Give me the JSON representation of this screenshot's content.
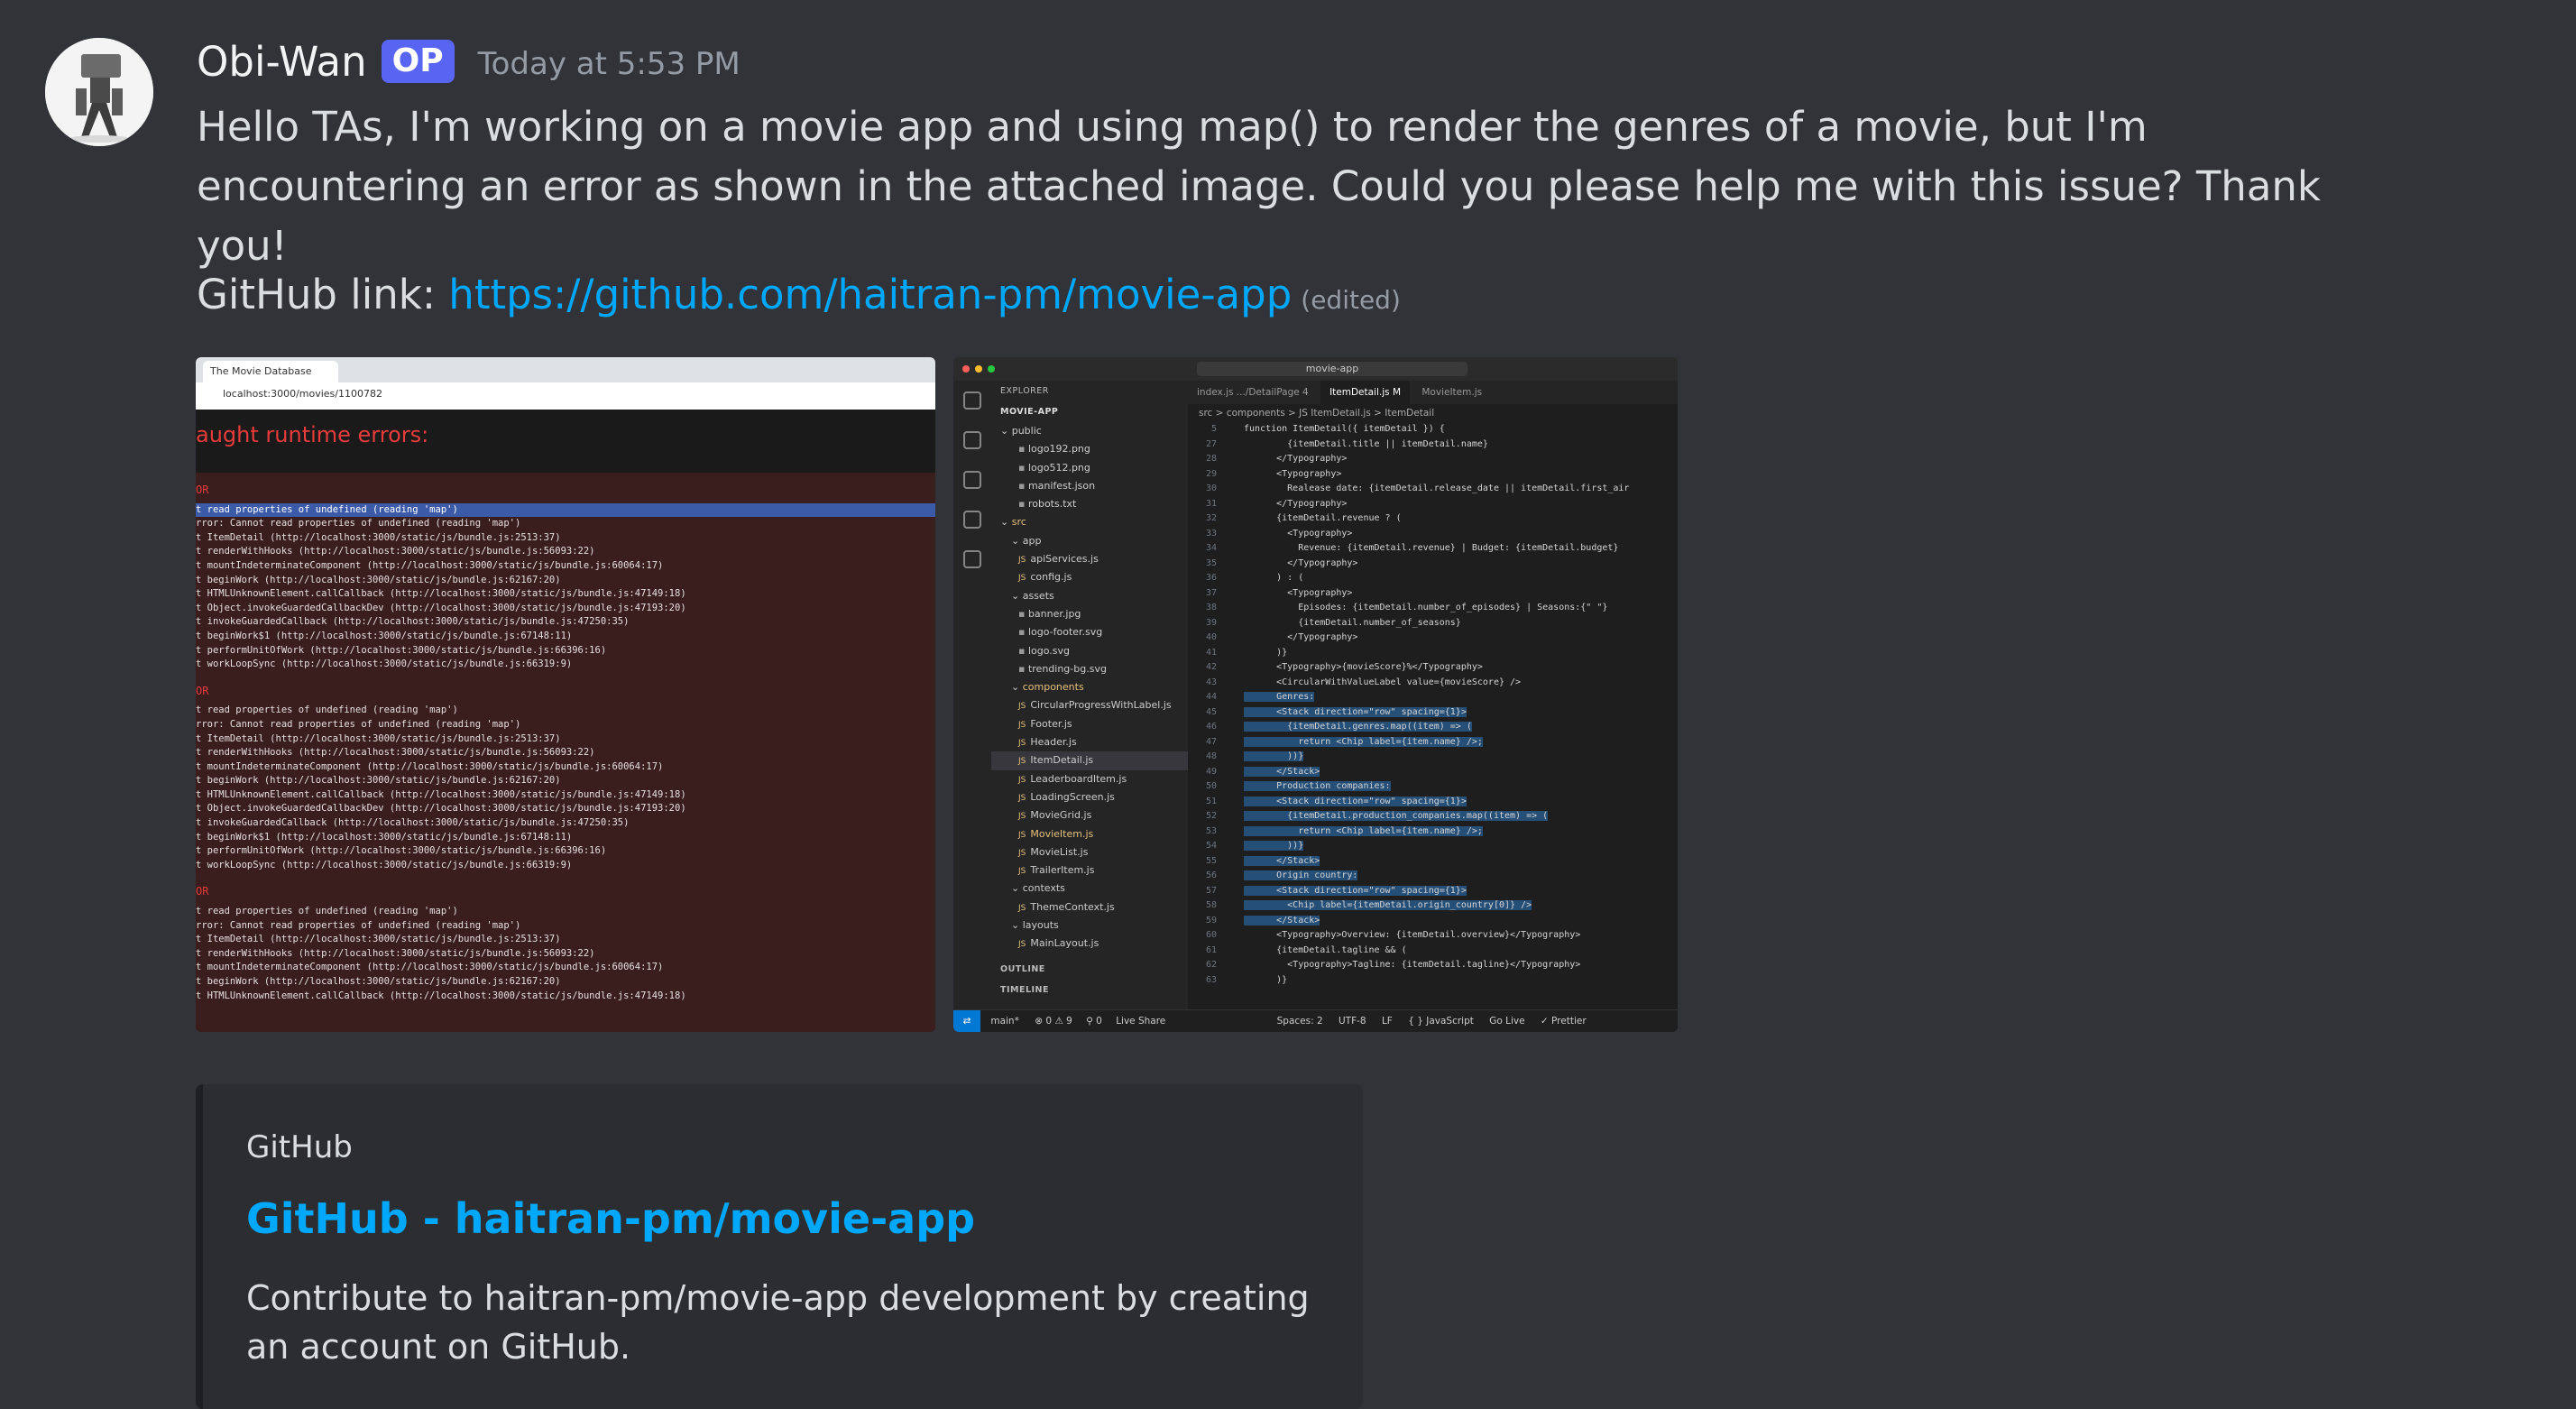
{
  "message": {
    "author": "Obi-Wan",
    "badge": "OP",
    "timestamp": "Today at 5:53 PM",
    "text": "Hello TAs, I'm working on a movie app and using map() to render the genres of a movie, but I'm encountering an error as shown in the attached image. Could you please help me with this issue? Thank you!",
    "github_prefix": "GitHub link: ",
    "github_url": "https://github.com/haitran-pm/movie-app",
    "edited": "(edited)"
  },
  "attachment_browser": {
    "tab_title": "The Movie Database",
    "url": "localhost:3000/movies/1100782",
    "heading": "aught runtime errors:",
    "error_header": "OR",
    "lines": [
      "t read properties of undefined (reading 'map')",
      "rror: Cannot read properties of undefined (reading 'map')",
      "t ItemDetail (http://localhost:3000/static/js/bundle.js:2513:37)",
      "t renderWithHooks (http://localhost:3000/static/js/bundle.js:56093:22)",
      "t mountIndeterminateComponent (http://localhost:3000/static/js/bundle.js:60064:17)",
      "t beginWork (http://localhost:3000/static/js/bundle.js:62167:20)",
      "t HTMLUnknownElement.callCallback (http://localhost:3000/static/js/bundle.js:47149:18)",
      "t Object.invokeGuardedCallbackDev (http://localhost:3000/static/js/bundle.js:47193:20)",
      "t invokeGuardedCallback (http://localhost:3000/static/js/bundle.js:47250:35)",
      "t beginWork$1 (http://localhost:3000/static/js/bundle.js:67148:11)",
      "t performUnitOfWork (http://localhost:3000/static/js/bundle.js:66396:16)",
      "t workLoopSync (http://localhost:3000/static/js/bundle.js:66319:9)"
    ]
  },
  "attachment_vscode": {
    "search": "movie-app",
    "explorer_title": "EXPLORER",
    "project": "MOVIE-APP",
    "files": [
      {
        "name": "public",
        "kind": "folder"
      },
      {
        "name": "logo192.png",
        "kind": "file"
      },
      {
        "name": "logo512.png",
        "kind": "file"
      },
      {
        "name": "manifest.json",
        "kind": "file"
      },
      {
        "name": "robots.txt",
        "kind": "file"
      },
      {
        "name": "src",
        "kind": "folder"
      },
      {
        "name": "app",
        "kind": "folder"
      },
      {
        "name": "apiServices.js",
        "kind": "js"
      },
      {
        "name": "config.js",
        "kind": "js"
      },
      {
        "name": "assets",
        "kind": "folder"
      },
      {
        "name": "banner.jpg",
        "kind": "file"
      },
      {
        "name": "logo-footer.svg",
        "kind": "file"
      },
      {
        "name": "logo.svg",
        "kind": "file"
      },
      {
        "name": "trending-bg.svg",
        "kind": "file"
      },
      {
        "name": "components",
        "kind": "folder"
      },
      {
        "name": "CircularProgressWithLabel.js",
        "kind": "js"
      },
      {
        "name": "Footer.js",
        "kind": "js"
      },
      {
        "name": "Header.js",
        "kind": "js"
      },
      {
        "name": "ItemDetail.js",
        "kind": "js"
      },
      {
        "name": "LeaderboardItem.js",
        "kind": "js"
      },
      {
        "name": "LoadingScreen.js",
        "kind": "js"
      },
      {
        "name": "MovieGrid.js",
        "kind": "js"
      },
      {
        "name": "MovieItem.js",
        "kind": "js"
      },
      {
        "name": "MovieList.js",
        "kind": "js"
      },
      {
        "name": "TrailerItem.js",
        "kind": "js"
      },
      {
        "name": "contexts",
        "kind": "folder"
      },
      {
        "name": "ThemeContext.js",
        "kind": "js"
      },
      {
        "name": "layouts",
        "kind": "folder"
      },
      {
        "name": "MainLayout.js",
        "kind": "js"
      }
    ],
    "outline": "OUTLINE",
    "timeline": "TIMELINE",
    "tabs": [
      "index.js .../DetailPage 4",
      "ItemDetail.js M",
      "MovieItem.js"
    ],
    "breadcrumb": "src > components > JS ItemDetail.js > ItemDetail",
    "code": [
      {
        "n": "5",
        "t": "function ItemDetail({ itemDetail }) {",
        "sel": false
      },
      {
        "n": "27",
        "t": "        {itemDetail.title || itemDetail.name}",
        "sel": false
      },
      {
        "n": "28",
        "t": "      </Typography>",
        "sel": false
      },
      {
        "n": "29",
        "t": "      <Typography>",
        "sel": false
      },
      {
        "n": "30",
        "t": "        Realease date: {itemDetail.release_date || itemDetail.first_air",
        "sel": false
      },
      {
        "n": "31",
        "t": "      </Typography>",
        "sel": false
      },
      {
        "n": "32",
        "t": "      {itemDetail.revenue ? (",
        "sel": false
      },
      {
        "n": "33",
        "t": "        <Typography>",
        "sel": false
      },
      {
        "n": "34",
        "t": "          Revenue: {itemDetail.revenue} | Budget: {itemDetail.budget}",
        "sel": false
      },
      {
        "n": "35",
        "t": "        </Typography>",
        "sel": false
      },
      {
        "n": "36",
        "t": "      ) : (",
        "sel": false
      },
      {
        "n": "37",
        "t": "        <Typography>",
        "sel": false
      },
      {
        "n": "38",
        "t": "          Episodes: {itemDetail.number_of_episodes} | Seasons:{\" \"}",
        "sel": false
      },
      {
        "n": "39",
        "t": "          {itemDetail.number_of_seasons}",
        "sel": false
      },
      {
        "n": "40",
        "t": "        </Typography>",
        "sel": false
      },
      {
        "n": "41",
        "t": "      )}",
        "sel": false
      },
      {
        "n": "42",
        "t": "      <Typography>{movieScore}%</Typography>",
        "sel": false
      },
      {
        "n": "43",
        "t": "      <CircularWithValueLabel value={movieScore} />",
        "sel": false
      },
      {
        "n": "44",
        "t": "      Genres:",
        "sel": true
      },
      {
        "n": "45",
        "t": "      <Stack direction=\"row\" spacing={1}>",
        "sel": true
      },
      {
        "n": "46",
        "t": "        {itemDetail.genres.map((item) => (",
        "sel": true
      },
      {
        "n": "47",
        "t": "          return <Chip label={item.name} />;",
        "sel": true
      },
      {
        "n": "48",
        "t": "        ))}",
        "sel": true
      },
      {
        "n": "49",
        "t": "      </Stack>",
        "sel": true
      },
      {
        "n": "50",
        "t": "      Production companies:",
        "sel": true
      },
      {
        "n": "51",
        "t": "      <Stack direction=\"row\" spacing={1}>",
        "sel": true
      },
      {
        "n": "52",
        "t": "        {itemDetail.production_companies.map((item) => (",
        "sel": true
      },
      {
        "n": "53",
        "t": "          return <Chip label={item.name} />;",
        "sel": true
      },
      {
        "n": "54",
        "t": "        ))}",
        "sel": true
      },
      {
        "n": "55",
        "t": "      </Stack>",
        "sel": true
      },
      {
        "n": "56",
        "t": "      Origin country:",
        "sel": true
      },
      {
        "n": "57",
        "t": "      <Stack direction=\"row\" spacing={1}>",
        "sel": true
      },
      {
        "n": "58",
        "t": "        <Chip label={itemDetail.origin_country[0]} />",
        "sel": true
      },
      {
        "n": "59",
        "t": "      </Stack>",
        "sel": true
      },
      {
        "n": "60",
        "t": "      <Typography>Overview: {itemDetail.overview}</Typography>",
        "sel": false
      },
      {
        "n": "61",
        "t": "      {itemDetail.tagline && (",
        "sel": false
      },
      {
        "n": "62",
        "t": "        <Typography>Tagline: {itemDetail.tagline}</Typography>",
        "sel": false
      },
      {
        "n": "63",
        "t": "      )}",
        "sel": false
      }
    ],
    "status": {
      "branch": "main*",
      "problems": "⊗ 0 ⚠ 9",
      "ports": "⚲ 0",
      "live_share": "Live Share",
      "spaces": "Spaces: 2",
      "encoding": "UTF-8",
      "eol": "LF",
      "language": "{ } JavaScript",
      "go_live": "Go Live",
      "prettier": "✓ Prettier"
    }
  },
  "embed": {
    "provider": "GitHub",
    "title": "GitHub - haitran-pm/movie-app",
    "description": "Contribute to haitran-pm/movie-app development by creating an account on GitHub."
  }
}
